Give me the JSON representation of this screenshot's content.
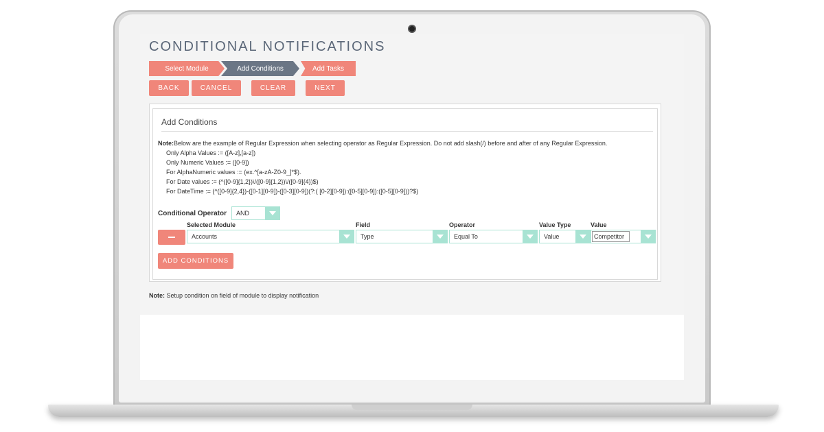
{
  "page": {
    "title": "CONDITIONAL NOTIFICATIONS"
  },
  "steps": [
    {
      "label": "Select Module",
      "state": "done"
    },
    {
      "label": "Add Conditions",
      "state": "active"
    },
    {
      "label": "Add Tasks",
      "state": "pending"
    }
  ],
  "buttons": {
    "back": "BACK",
    "cancel": "CANCEL",
    "clear": "CLEAR",
    "next": "NEXT"
  },
  "panel": {
    "title": "Add Conditions",
    "note_prefix": "Note:",
    "note_text": "Below are the example of Regular Expression when selecting operator as Regular Expression. Do not add slash(/) before and after of any Regular Expression.",
    "examples": [
      "Only Alpha Values := ([A-z],[a-z])",
      "Only Numeric Values := ([0-9])",
      "For AlphaNumeric values := (ex.^[a-zA-Z0-9_]*$).",
      "For Date values := (^([0-9]{1,2})\\/([0-9]{1,2})\\/([0-9]{4})$)",
      "For DateTime := (^([0-9]{2,4})-([0-1][0-9])-([0-3][0-9])(?:( [0-2][0-9]):([0-5][0-9]):([0-5][0-9]))?$)"
    ],
    "conditional_operator_label": "Conditional Operator",
    "conditional_operator_value": "AND",
    "columns": {
      "module": "Selected Module",
      "field": "Field",
      "operator": "Operator",
      "value_type": "Value Type",
      "value": "Value"
    },
    "row": {
      "module": "Accounts",
      "field": "Type",
      "operator": "Equal To",
      "value_type": "Value",
      "value": "Competitor"
    },
    "add_conditions_label": "ADD CONDITIONS"
  },
  "footer": {
    "note_prefix": "Note:",
    "note_text": "Setup condition on field of module to display notification"
  },
  "colors": {
    "accent": "#f0867a",
    "active_step": "#6b7685",
    "select_accent": "#a8e3d3",
    "title": "#5b6778"
  }
}
